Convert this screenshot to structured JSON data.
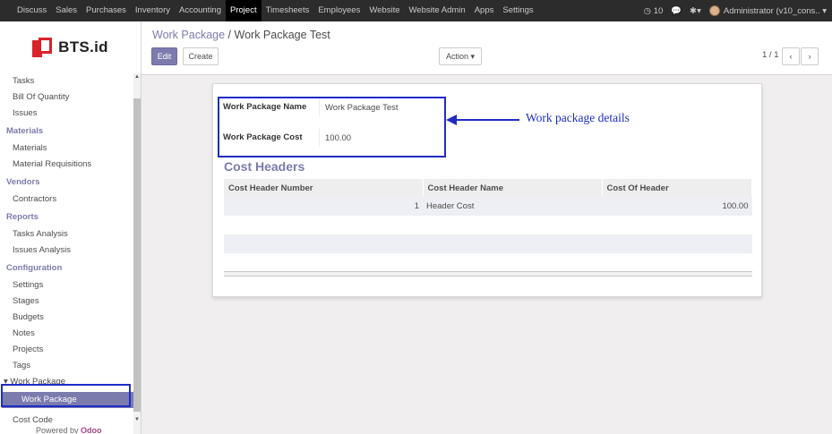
{
  "topbar": {
    "menu": [
      "Discuss",
      "Sales",
      "Purchases",
      "Inventory",
      "Accounting",
      "Project",
      "Timesheets",
      "Employees",
      "Website",
      "Website Admin",
      "Apps",
      "Settings"
    ],
    "active_menu": "Project",
    "messages_count": "10",
    "user": "Administrator (v10_cons..",
    "icons": [
      "clock-icon",
      "chat-icon",
      "bug-icon",
      "caret-down-icon"
    ]
  },
  "logo": {
    "text": "BTS.id"
  },
  "sidebar": {
    "groups": [
      {
        "header": "",
        "items": [
          "Tasks",
          "Bill Of Quantity",
          "Issues"
        ]
      },
      {
        "header": "Materials",
        "items": [
          "Materials",
          "Material Requisitions"
        ]
      },
      {
        "header": "Vendors",
        "items": [
          "Contractors"
        ]
      },
      {
        "header": "Reports",
        "items": [
          "Tasks Analysis",
          "Issues Analysis"
        ]
      },
      {
        "header": "Configuration",
        "items": [
          "Settings",
          "Stages",
          "Budgets",
          "Notes",
          "Projects",
          "Tags"
        ]
      }
    ],
    "collapsible": "Work Package",
    "active_item": "Work Package",
    "after_item": "Cost Code",
    "powered_prefix": "Powered by",
    "powered_brand": "Odoo"
  },
  "breadcrumb": {
    "parent": "Work Package",
    "separator": "/",
    "current": "Work Package Test"
  },
  "buttons": {
    "edit": "Edit",
    "create": "Create",
    "action": "Action"
  },
  "pager": {
    "value": "1 / 1"
  },
  "form": {
    "name_label": "Work Package Name",
    "name_value": "Work Package Test",
    "cost_label": "Work Package Cost",
    "cost_value": "100.00",
    "section_title": "Cost Headers",
    "columns": [
      "Cost Header Number",
      "Cost Header Name",
      "Cost Of Header"
    ],
    "rows": [
      {
        "number": "1",
        "name": "Header Cost",
        "cost": "100.00"
      }
    ]
  },
  "annotation": {
    "label": "Work package details",
    "color": "#1f2cc6"
  },
  "colors": {
    "accent": "#7c7bad",
    "topbar": "#2c2c2c",
    "logo_red": "#d8232a"
  }
}
